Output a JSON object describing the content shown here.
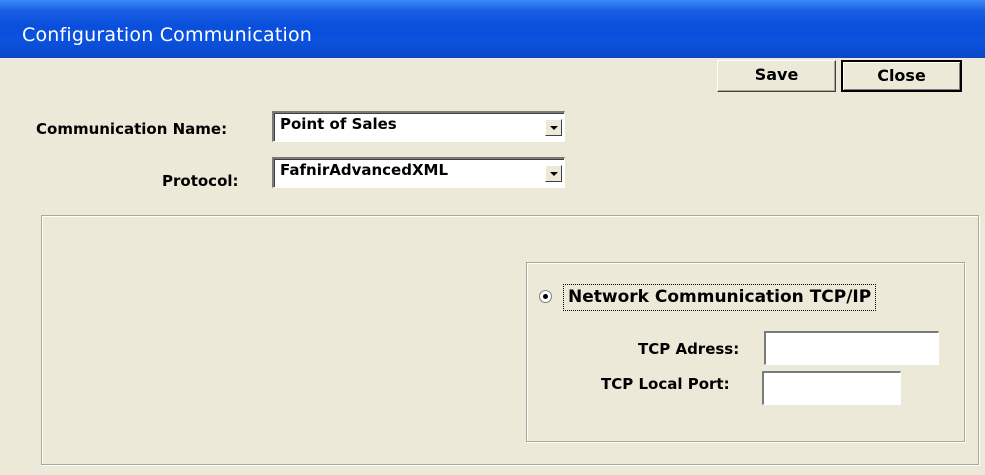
{
  "window": {
    "title": "Configuration Communication"
  },
  "toolbar": {
    "save_label": "Save",
    "close_label": "Close"
  },
  "form": {
    "communication_name_label": "Communication Name:",
    "communication_name_value": "Point of Sales",
    "protocol_label": "Protocol:",
    "protocol_value": "FafnirAdvancedXML"
  },
  "network": {
    "radio_label": "Network Communication TCP/IP",
    "radio_selected": true,
    "tcp_address_label": "TCP Adress:",
    "tcp_address_value": "",
    "tcp_local_port_label": "TCP Local Port:",
    "tcp_local_port_value": ""
  }
}
